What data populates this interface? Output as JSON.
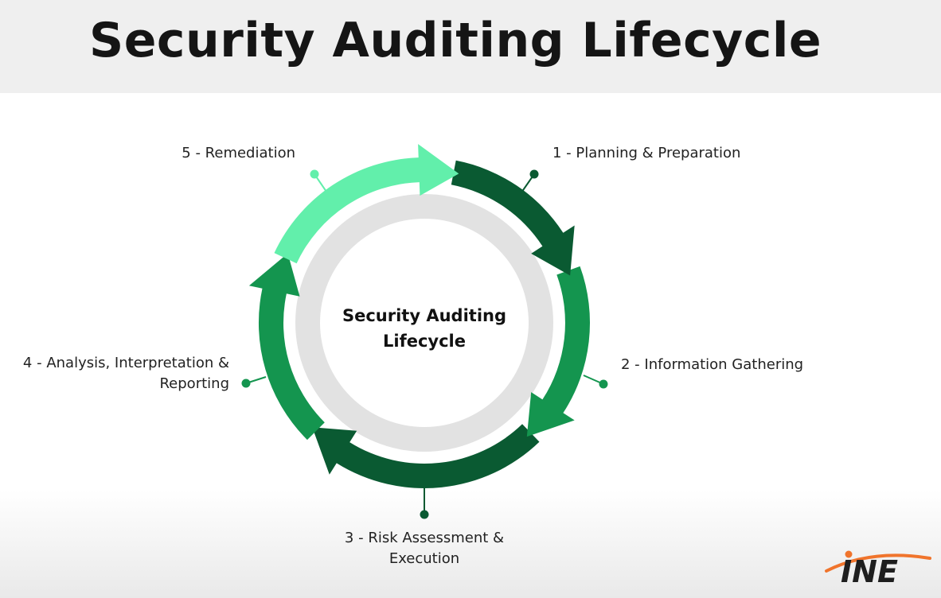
{
  "title": "Security Auditing Lifecycle",
  "center": {
    "line1": "Security Auditing",
    "line2": "Lifecycle"
  },
  "stages": [
    {
      "lines": [
        "1 - Planning & Preparation"
      ]
    },
    {
      "lines": [
        "2 - Information Gathering"
      ]
    },
    {
      "lines": [
        "3 - Risk Assessment &",
        "Execution"
      ]
    },
    {
      "lines": [
        "4 - Analysis, Interpretation &",
        "Reporting"
      ]
    },
    {
      "lines": [
        "5 - Remediation"
      ]
    }
  ],
  "colors": {
    "dark_green": "#0a5a32",
    "mid_green": "#14954f",
    "light_green": "#62efab",
    "ring_gray": "#e2e2e2",
    "inner_white": "#ffffff",
    "logo_orange": "#f0742c",
    "logo_dark": "#1e1e1e"
  },
  "logo": {
    "text": "INE"
  }
}
